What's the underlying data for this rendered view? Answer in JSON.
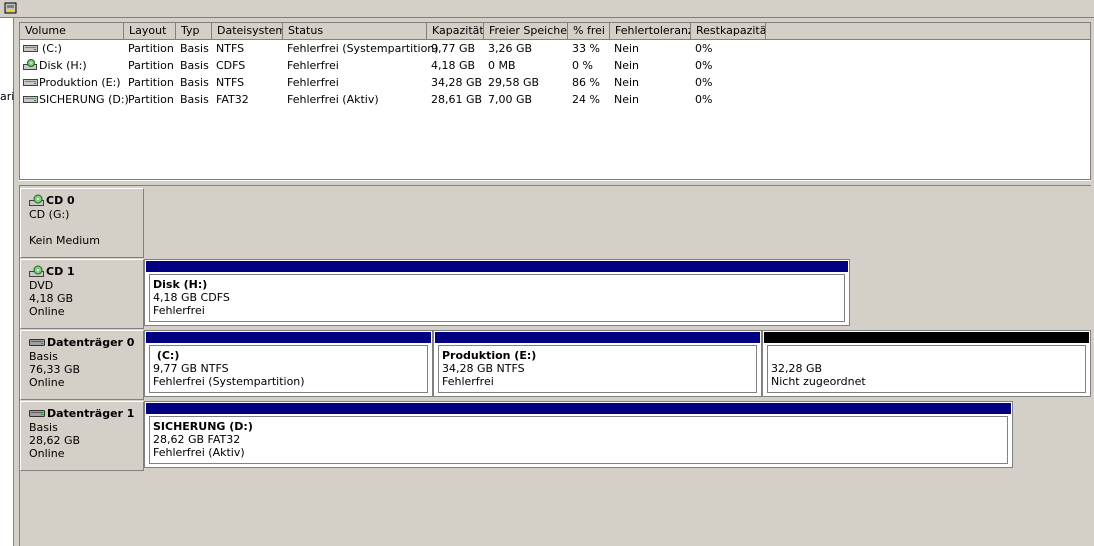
{
  "left_pane": {
    "text": "ari"
  },
  "volume_list": {
    "columns": [
      "Volume",
      "Layout",
      "Typ",
      "Dateisystem",
      "Status",
      "Kapazität",
      "Freier Speicher",
      "% frei",
      "Fehlertoleranz",
      "Restkapazität"
    ],
    "rows": [
      {
        "icon": "hard-disk-icon",
        "volume": "(C:)",
        "layout": "Partition",
        "type": "Basis",
        "fs": "NTFS",
        "status": "Fehlerfrei (Systempartition)",
        "capacity": "9,77 GB",
        "free": "3,26 GB",
        "pct_free": "33 %",
        "fault": "Nein",
        "overhead": "0%"
      },
      {
        "icon": "cd-drive-icon",
        "volume": "Disk (H:)",
        "layout": "Partition",
        "type": "Basis",
        "fs": "CDFS",
        "status": "Fehlerfrei",
        "capacity": "4,18 GB",
        "free": "0 MB",
        "pct_free": "0 %",
        "fault": "Nein",
        "overhead": "0%"
      },
      {
        "icon": "hard-disk-icon",
        "volume": "Produktion (E:)",
        "layout": "Partition",
        "type": "Basis",
        "fs": "NTFS",
        "status": "Fehlerfrei",
        "capacity": "34,28 GB",
        "free": "29,58 GB",
        "pct_free": "86 %",
        "fault": "Nein",
        "overhead": "0%"
      },
      {
        "icon": "hard-disk-icon",
        "volume": "SICHERUNG (D:)",
        "layout": "Partition",
        "type": "Basis",
        "fs": "FAT32",
        "status": "Fehlerfrei (Aktiv)",
        "capacity": "28,61 GB",
        "free": "7,00 GB",
        "pct_free": "24 %",
        "fault": "Nein",
        "overhead": "0%"
      }
    ]
  },
  "disks": [
    {
      "name": "CD 0",
      "line1": "CD (G:)",
      "line2": "",
      "line3": "Kein Medium",
      "partitions": []
    },
    {
      "name": "CD 1",
      "line1": "DVD",
      "line2": "4,18 GB",
      "line3": "Online",
      "partitions": [
        {
          "title": "Disk  (H:)",
          "size": "4,18 GB CDFS",
          "status": "Fehlerfrei"
        }
      ]
    },
    {
      "name": "Datenträger 0",
      "line1": "Basis",
      "line2": "76,33 GB",
      "line3": "Online",
      "partitions": [
        {
          "title": " (C:)",
          "size": "9,77 GB NTFS",
          "status": "Fehlerfrei (Systempartition)"
        },
        {
          "title": "Produktion  (E:)",
          "size": "34,28 GB NTFS",
          "status": "Fehlerfrei"
        },
        {
          "title": "",
          "size": "32,28 GB",
          "status": "Nicht zugeordnet"
        }
      ]
    },
    {
      "name": "Datenträger 1",
      "line1": "Basis",
      "line2": "28,62 GB",
      "line3": "Online",
      "partitions": [
        {
          "title": "SICHERUNG  (D:)",
          "size": "28,62 GB FAT32",
          "status": "Fehlerfrei (Aktiv)"
        }
      ]
    }
  ]
}
